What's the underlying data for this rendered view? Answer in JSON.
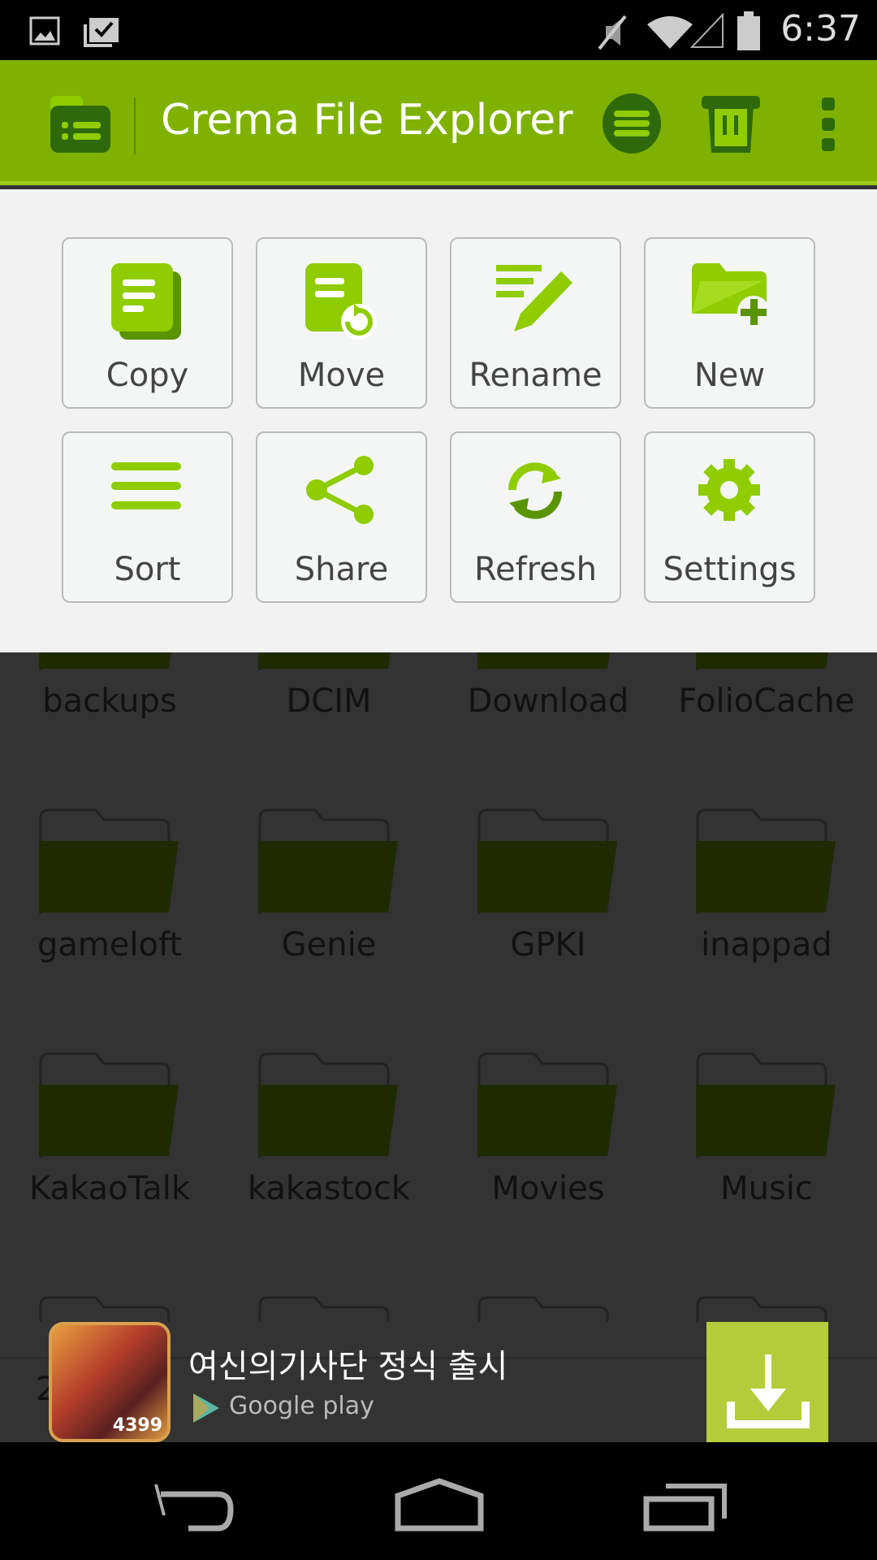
{
  "status_bar": {
    "time": "6:37",
    "icons": [
      "gallery-icon",
      "clipboard-check-icon",
      "mute-icon",
      "wifi-icon",
      "signal-icon",
      "battery-icon"
    ]
  },
  "app_bar": {
    "title": "Crema File Explorer",
    "actions": [
      "list-view-icon",
      "trash-icon",
      "overflow-menu-icon"
    ]
  },
  "menu": {
    "items": [
      {
        "label": "Copy",
        "icon": "copy-icon"
      },
      {
        "label": "Move",
        "icon": "move-icon"
      },
      {
        "label": "Rename",
        "icon": "rename-icon"
      },
      {
        "label": "New",
        "icon": "new-folder-icon"
      },
      {
        "label": "Sort",
        "icon": "sort-icon"
      },
      {
        "label": "Share",
        "icon": "share-icon"
      },
      {
        "label": "Refresh",
        "icon": "refresh-icon"
      },
      {
        "label": "Settings",
        "icon": "settings-icon"
      }
    ]
  },
  "folders": [
    "backups",
    "DCIM",
    "Download",
    "FolioCache",
    "gameloft",
    "Genie",
    "GPKI",
    "inappad",
    "KakaoTalk",
    "kakastock",
    "Movies",
    "Music"
  ],
  "partial_text": "2",
  "ad": {
    "title": "여신의기사단 정식 출시",
    "store": "Google play",
    "badge": "4399",
    "accent": "#b5cc3a"
  },
  "colors": {
    "appbar": "#7fb200",
    "icon_green": "#8fcc00",
    "overlay": "#333333"
  }
}
